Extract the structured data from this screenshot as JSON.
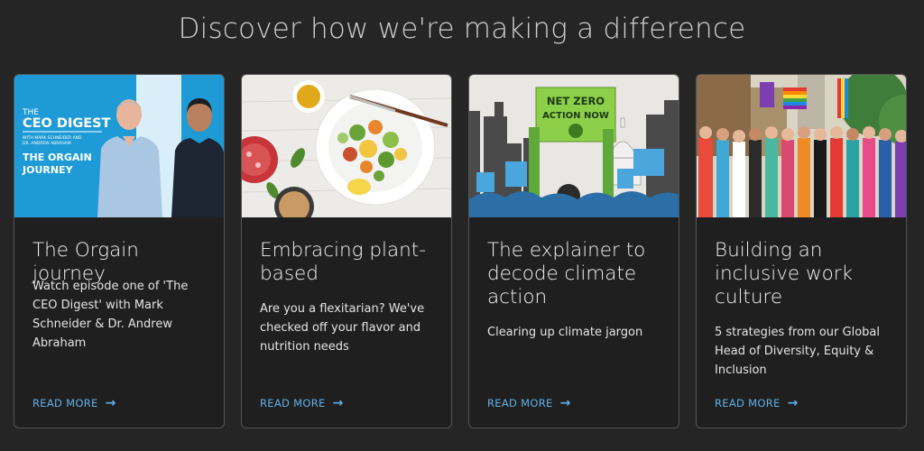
{
  "heading": "Discover how we're making a difference",
  "cards": [
    {
      "title": "The Orgain journey",
      "description": "Watch episode one of 'The CEO Digest' with Mark Schneider & Dr. Andrew Abraham",
      "link": "READ MORE",
      "image": {
        "small_label": "THE",
        "logo": "CEO DIGEST",
        "with_line1": "WITH MARK SCHNEIDER AND",
        "with_line2": "DR. ANDREW ABRAHAM",
        "episode_line1": "THE ORGAIN",
        "episode_line2": "JOURNEY"
      }
    },
    {
      "title": "Embracing plant-based",
      "description": "Are you a flexitarian? We've checked off your flavor and nutrition needs",
      "link": "READ MORE"
    },
    {
      "title": "The explainer to decode climate action",
      "description": "Clearing up climate jargon",
      "link": "READ MORE",
      "image": {
        "sign_line1": "NET ZERO",
        "sign_line2": "ACTION NOW"
      }
    },
    {
      "title": "Building an inclusive work culture",
      "description": "5 strategies from our Global Head of Diversity, Equity & Inclusion",
      "link": "READ MORE"
    }
  ],
  "colors": {
    "background": "#252525",
    "card": "#1f1f1f",
    "link": "#5fb0e8",
    "ceo_blue": "#1e9bd7"
  }
}
